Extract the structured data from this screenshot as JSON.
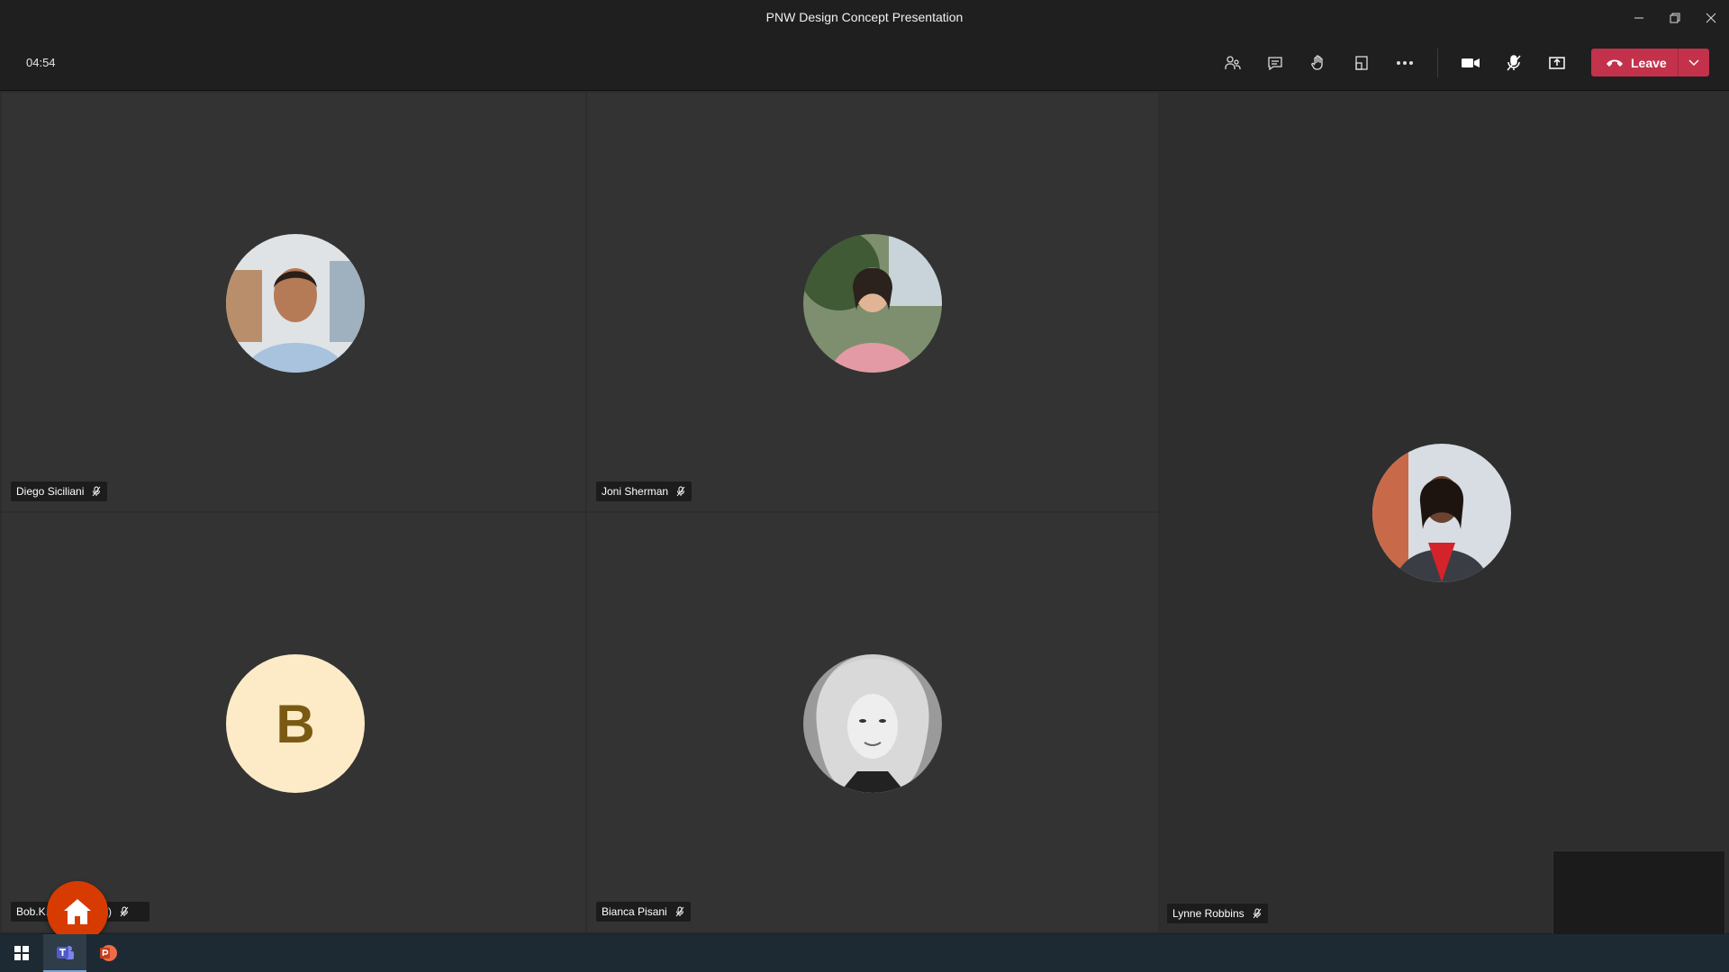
{
  "window": {
    "title": "PNW Design Concept Presentation"
  },
  "toolbar": {
    "timer": "04:54",
    "leave_label": "Leave",
    "icons": [
      "participants-icon",
      "chat-icon",
      "raise-hand-icon",
      "rooms-icon",
      "more-icon",
      "camera-icon",
      "mic-off-icon",
      "share-icon"
    ]
  },
  "participants": [
    {
      "name": "Diego Siciliani"
    },
    {
      "name": "Joni Sherman"
    },
    {
      "name": "Lynne Robbins"
    },
    {
      "name": "Bob.K.",
      "name_tail": "est)",
      "initial": "B"
    },
    {
      "name": "Bianca Pisani"
    }
  ],
  "colors": {
    "leave": "#c4314b",
    "home": "#d83b01",
    "initial_bg": "#fdebc8",
    "initial_fg": "#7a5a13"
  }
}
